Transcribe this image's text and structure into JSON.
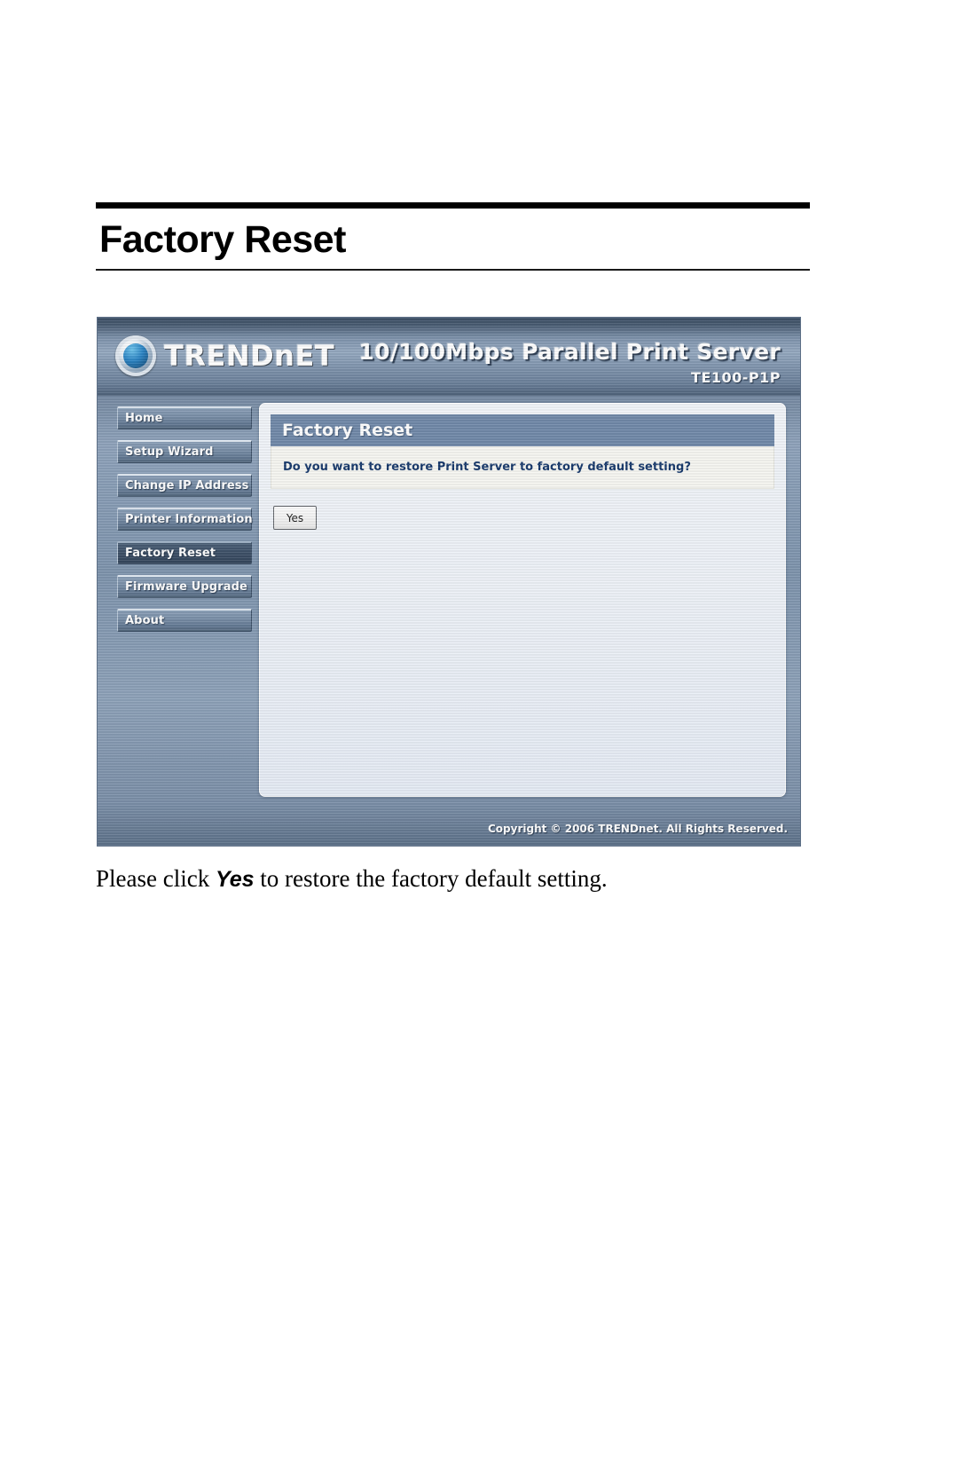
{
  "page": {
    "title": "Factory Reset",
    "caption_before": "Please click ",
    "caption_keyword": "Yes",
    "caption_after": " to restore the factory default setting."
  },
  "device_ui": {
    "brand_name": "TRENDnET",
    "product_name": "10/100Mbps Parallel Print Server",
    "product_model": "TE100-P1P",
    "nav": {
      "items": [
        {
          "label": "Home",
          "active": false
        },
        {
          "label": "Setup Wizard",
          "active": false
        },
        {
          "label": "Change IP Address",
          "active": false
        },
        {
          "label": "Printer Information",
          "active": false
        },
        {
          "label": "Factory Reset",
          "active": true
        },
        {
          "label": "Firmware Upgrade",
          "active": false
        },
        {
          "label": "About",
          "active": false
        }
      ]
    },
    "content": {
      "heading": "Factory Reset",
      "question": "Do you want to restore Print Server to factory default setting?",
      "yes_button": "Yes"
    },
    "footer": {
      "copyright": "Copyright © 2006 TRENDnet. All Rights Reserved."
    },
    "colors": {
      "banner_blue": "#8fa3bb",
      "content_title_bar": "#7189a9",
      "question_text": "#16386b",
      "nav_active": "#3e5168"
    }
  }
}
